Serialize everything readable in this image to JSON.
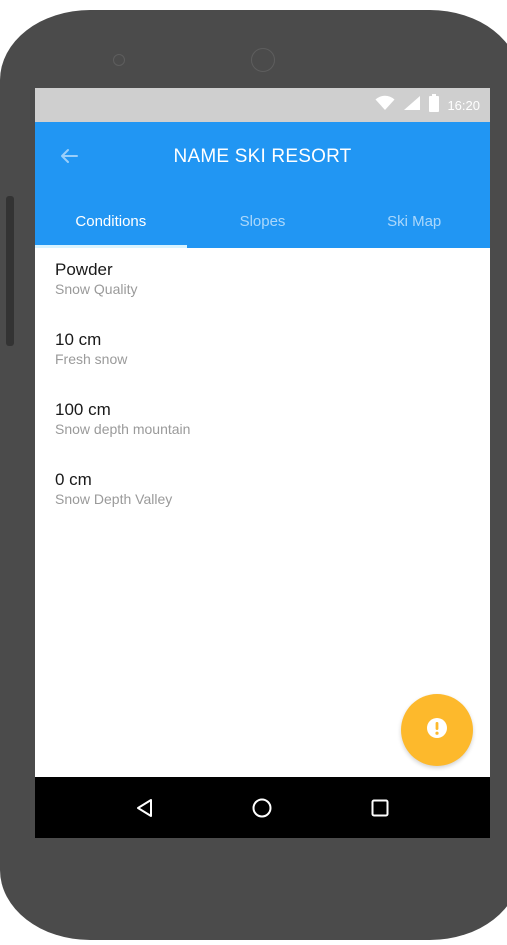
{
  "status_bar": {
    "time": "16:20",
    "icons": [
      "wifi-icon",
      "signal-icon",
      "battery-icon"
    ]
  },
  "app_bar": {
    "back_icon": "arrow-left-icon",
    "title": "NAME SKI RESORT"
  },
  "tabs": [
    {
      "label": "Conditions",
      "active": true
    },
    {
      "label": "Slopes",
      "active": false
    },
    {
      "label": "Ski Map",
      "active": false
    }
  ],
  "conditions": [
    {
      "value": "Powder",
      "label": "Snow Quality"
    },
    {
      "value": "10 cm",
      "label": "Fresh snow"
    },
    {
      "value": "100 cm",
      "label": "Snow depth mountain"
    },
    {
      "value": "0 cm",
      "label": "Snow Depth Valley"
    }
  ],
  "fab": {
    "icon": "alert-icon"
  },
  "nav_bar": {
    "icons": [
      "back-triangle-icon",
      "home-circle-icon",
      "recents-square-icon"
    ]
  },
  "colors": {
    "primary": "#2196f3",
    "accent": "#fdb92c",
    "status_bar": "#cfcfcf",
    "device_body": "#4b4b4b"
  }
}
